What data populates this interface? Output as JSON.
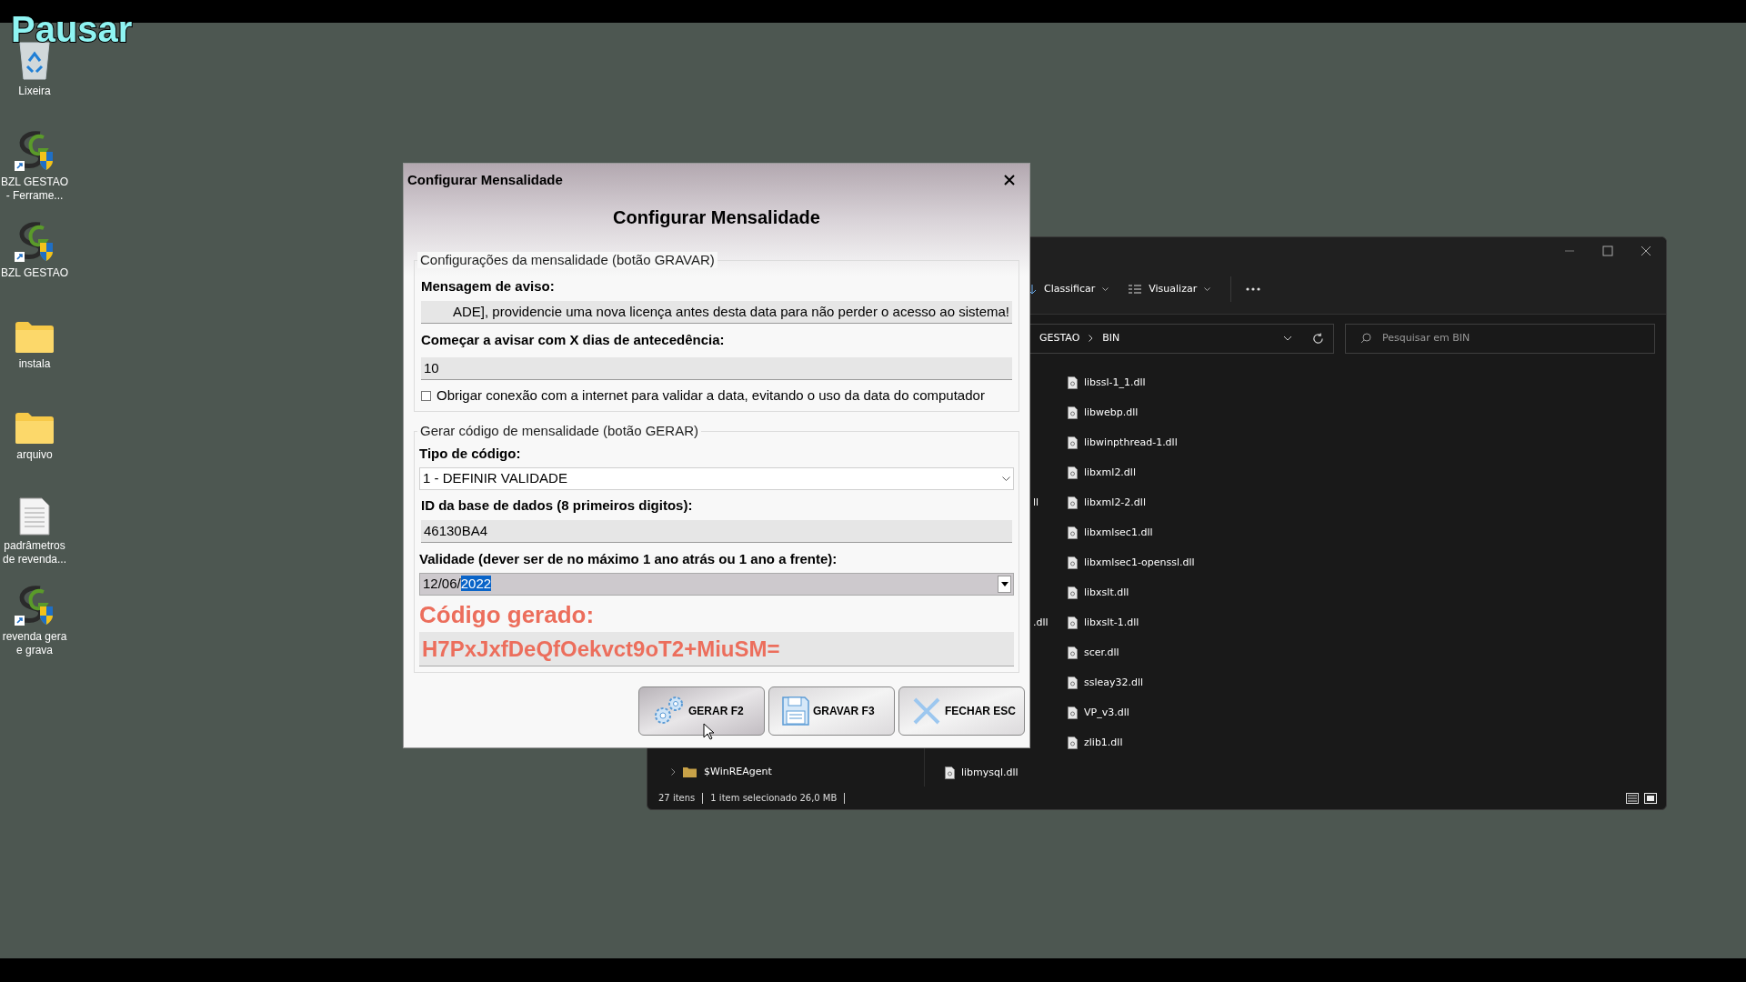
{
  "overlay_text": "Pausar",
  "desktop_icons": [
    {
      "kind": "recycle",
      "label": "Lixeira"
    },
    {
      "kind": "app",
      "label": "BZL GESTAO\n- Ferrame..."
    },
    {
      "kind": "app",
      "label": "BZL GESTAO"
    },
    {
      "kind": "folder",
      "label": "instala"
    },
    {
      "kind": "folder",
      "label": "arquivo"
    },
    {
      "kind": "document",
      "label": "padrâmetros\nde revenda..."
    },
    {
      "kind": "app",
      "label": "revenda gera\ne grava"
    }
  ],
  "explorer": {
    "toolbar": [
      {
        "kind": "sort",
        "label": "Classificar"
      },
      {
        "kind": "view",
        "label": "Visualizar"
      }
    ],
    "breadcrumb": [
      "GESTAO",
      "BIN"
    ],
    "search": {
      "placeholder": "Pesquisar em BIN"
    },
    "nav_items": [
      {
        "label": "$WinREAgent"
      }
    ],
    "files": [
      "libssl-1_1.dll",
      "libwebp.dll",
      "libwinpthread-1.dll",
      "libxml2.dll",
      "libxml2-2.dll",
      "libxmlsec1.dll",
      "libxmlsec1-openssl.dll",
      "libxslt.dll",
      "libxslt-1.dll",
      "scer.dll",
      "ssleay32.dll",
      "VP_v3.dll",
      "zlib1.dll"
    ],
    "files_other_column": [
      {
        "label": "ll"
      },
      {
        "label": ".dll"
      },
      {
        "label": "libmysql.dll"
      }
    ],
    "status": [
      "27 itens",
      "1 item selecionado  26,0 MB"
    ]
  },
  "dialog": {
    "title": "Configurar Mensalidade",
    "heading": "Configurar Mensalidade",
    "settings_group": {
      "legend": "Configurações da mensalidade (botão GRAVAR)",
      "message_label": "Mensagem de aviso:",
      "message_value": "ADE], providencie uma nova licença antes desta data para não perder o acesso ao sistema!",
      "days_label": "Começar a avisar com X dias de antecedência:",
      "days_value": "10",
      "checkbox": {
        "label": "Obrigar conexão com a internet para validar a data, evitando o uso da data do computador",
        "checked": false
      }
    },
    "generate_group": {
      "legend": "Gerar código de mensalidade (botão GERAR)",
      "type_label": "Tipo de código:",
      "type_value": "1 - DEFINIR VALIDADE",
      "id_label": "ID da base de dados (8 primeiros digitos):",
      "id_value": "46130BA4",
      "date_label": "Validade (dever ser de no máximo 1 ano atrás ou 1 ano a frente):",
      "date_parts": [
        {
          "text": "12/06/",
          "selected": false
        },
        {
          "text": "2022",
          "selected": true
        }
      ],
      "code_label": "Código gerado:",
      "code_value": "H7PxJxfDeQfOekvct9oT2+MiuSM="
    },
    "buttons": [
      {
        "kind": "generate",
        "label": "GERAR F2",
        "hovered": true
      },
      {
        "kind": "save",
        "label": "GRAVAR F3",
        "hovered": false
      },
      {
        "kind": "close",
        "label": "FECHAR ESC",
        "hovered": false
      }
    ]
  }
}
